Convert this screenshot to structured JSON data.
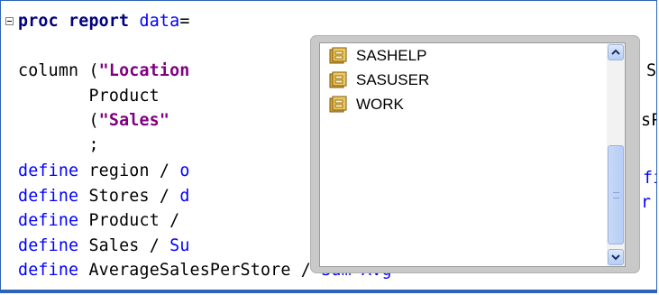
{
  "editor": {
    "lines": [
      {
        "segments": [
          {
            "t": "proc report",
            "c": "kw"
          },
          {
            "t": " ",
            "c": "plain"
          },
          {
            "t": "data",
            "c": "def"
          },
          {
            "t": "=",
            "c": "plain"
          }
        ]
      },
      {
        "segments": [
          {
            "t": "column (",
            "c": "plain"
          },
          {
            "t": "\"Location",
            "c": "str"
          }
        ]
      },
      {
        "segments": [
          {
            "t": "       Product",
            "c": "plain"
          }
        ]
      },
      {
        "segments": [
          {
            "t": "       (",
            "c": "plain"
          },
          {
            "t": "\"Sales\"",
            "c": "str"
          }
        ]
      },
      {
        "segments": [
          {
            "t": "       ;",
            "c": "plain"
          }
        ]
      },
      {
        "segments": [
          {
            "t": "define",
            "c": "def"
          },
          {
            "t": " region / ",
            "c": "plain"
          },
          {
            "t": "o",
            "c": "attr"
          }
        ]
      },
      {
        "segments": [
          {
            "t": "define",
            "c": "def"
          },
          {
            "t": " Stores / ",
            "c": "plain"
          },
          {
            "t": "d",
            "c": "attr"
          }
        ]
      },
      {
        "segments": [
          {
            "t": "define",
            "c": "def"
          },
          {
            "t": " Product /",
            "c": "plain"
          }
        ]
      },
      {
        "segments": [
          {
            "t": "define",
            "c": "def"
          },
          {
            "t": " Sales / ",
            "c": "plain"
          },
          {
            "t": "Su",
            "c": "attr"
          }
        ]
      },
      {
        "segments": [
          {
            "t": "define",
            "c": "def"
          },
          {
            "t": " AverageSalesPerStore / ",
            "c": "plain"
          },
          {
            "t": "Sum",
            "c": "attr"
          },
          {
            "t": " ",
            "c": "plain"
          },
          {
            "t": "Avg",
            "c": "attr"
          }
        ]
      }
    ],
    "right_fragments": [
      "S",
      "sP",
      "fi",
      "r"
    ]
  },
  "popup": {
    "libraries": [
      "SASHELP",
      "SASUSER",
      "WORK"
    ],
    "icon": "library-cabinet-icon"
  },
  "colors": {
    "keyword": "#000080",
    "define": "#0000ff",
    "string": "#800080",
    "accent_border": "#2e63b8"
  }
}
